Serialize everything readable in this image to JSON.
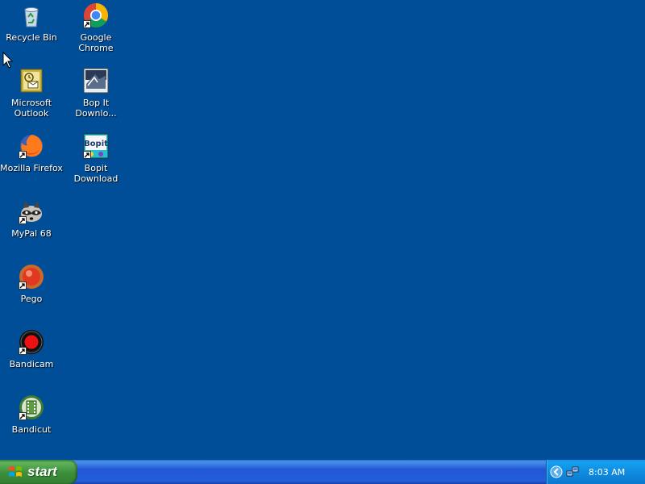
{
  "desktop": {
    "background": "#004E98",
    "icons": [
      {
        "label": "Recycle Bin",
        "icon": "recycle-bin-icon"
      },
      {
        "label": "Google Chrome",
        "icon": "chrome-icon"
      },
      {
        "label": "Microsoft\nOutlook",
        "icon": "outlook-icon"
      },
      {
        "label": "Bop It\nDownlo...",
        "icon": "bopit-download-icon"
      },
      {
        "label": "Mozilla Firefox",
        "icon": "firefox-icon"
      },
      {
        "label": "Bopit Download",
        "icon": "bopit-icon"
      },
      {
        "label": "MyPal 68",
        "icon": "mypal-icon"
      },
      {
        "label": "Pego",
        "icon": "pego-icon"
      },
      {
        "label": "Bandicam",
        "icon": "bandicam-icon"
      },
      {
        "label": "Bandicut",
        "icon": "bandicut-icon"
      }
    ]
  },
  "taskbar": {
    "start_label": "start",
    "clock": "8:03 AM",
    "tray_icons": [
      "keyboard-icon",
      "expand-tray-icon",
      "network-icon"
    ]
  }
}
